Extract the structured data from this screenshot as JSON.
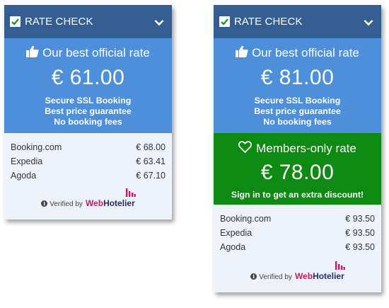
{
  "widgets": [
    {
      "header": {
        "title": "RATE CHECK"
      },
      "best": {
        "title": "Our best official rate",
        "price": "€ 61.00",
        "perks": [
          "Secure SSL Booking",
          "Best price guarantee",
          "No booking fees"
        ]
      },
      "rates": [
        {
          "site": "Booking.com",
          "price": "€ 68.00"
        },
        {
          "site": "Expedia",
          "price": "€ 63.41"
        },
        {
          "site": "Agoda",
          "price": "€ 67.10"
        }
      ],
      "verified": {
        "text": "Verified by",
        "brand_a": "Web",
        "brand_b": "Hotelier"
      }
    },
    {
      "header": {
        "title": "RATE CHECK"
      },
      "best": {
        "title": "Our best official rate",
        "price": "€ 81.00",
        "perks": [
          "Secure SSL Booking",
          "Best price guarantee",
          "No booking fees"
        ]
      },
      "members": {
        "title": "Members-only rate",
        "price": "€ 78.00",
        "cta": "Sign in to get an extra discount!"
      },
      "rates": [
        {
          "site": "Booking.com",
          "price": "€ 93.50"
        },
        {
          "site": "Expedia",
          "price": "€ 93.50"
        },
        {
          "site": "Agoda",
          "price": "€ 93.50"
        }
      ],
      "verified": {
        "text": "Verified by",
        "brand_a": "Web",
        "brand_b": "Hotelier"
      }
    }
  ],
  "colors": {
    "header": "#345e92",
    "best": "#4d8fdb",
    "members": "#0c8a12",
    "body": "#eef3fb",
    "brand_pink": "#c81c5c",
    "brand_navy": "#2a2a6a"
  },
  "icons": [
    "check-icon",
    "chevron-down-icon",
    "thumbs-up-icon",
    "heart-icon",
    "info-icon",
    "webhotelier-logo-icon"
  ]
}
